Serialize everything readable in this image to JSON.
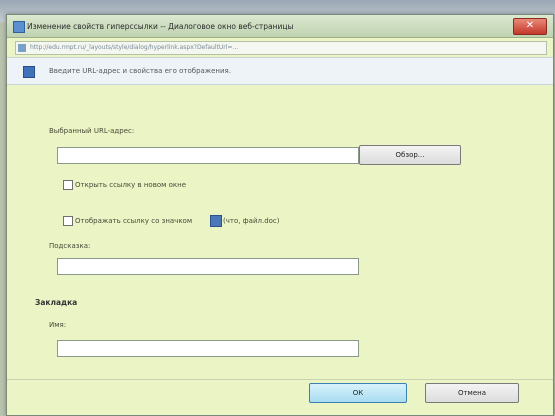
{
  "window": {
    "title": "Изменение свойств гиперссылки -- Диалоговое окно веб-страницы",
    "close_glyph": "✕",
    "address": "http://edu.rmpt.ru/_layouts/style/dialog/hyperlink.aspx?DefaultUrl=...",
    "info": "Введите URL-адрес и свойства его отображения."
  },
  "form": {
    "url_label": "Выбранный URL-адрес:",
    "url_value": "",
    "browse_label": "Обзор...",
    "new_window_label": "Открыть ссылку в новом окне",
    "show_icon_label": "Отображать ссылку со значком",
    "icon_hint": "(что, файл.doc)",
    "tooltip_label": "Подсказка:",
    "tooltip_value": "",
    "bookmark_section": "Закладка",
    "name_label": "Имя:",
    "name_value": ""
  },
  "buttons": {
    "ok": "ОК",
    "cancel": "Отмена"
  }
}
